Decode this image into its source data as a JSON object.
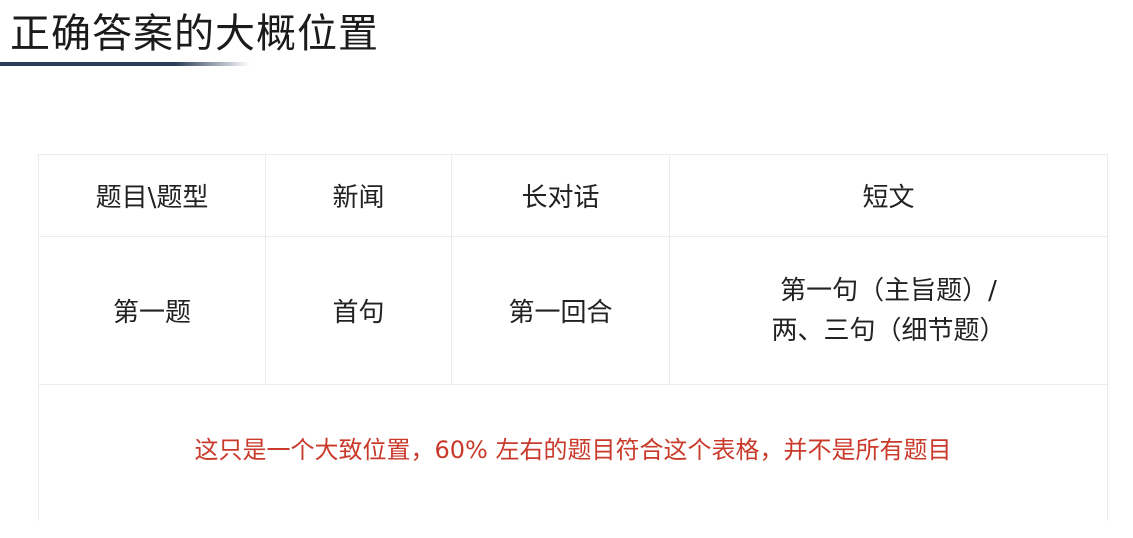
{
  "title": "正确答案的大概位置",
  "table": {
    "headers": [
      "题目\\题型",
      "新闻",
      "长对话",
      "短文"
    ],
    "row": {
      "label": "第一题",
      "news": "首句",
      "long_dialogue": "第一回合",
      "passage_line1": "第一句（主旨题）/",
      "passage_line2": "两、三句（细节题）"
    },
    "note": "这只是一个大致位置，60% 左右的题目符合这个表格，并不是所有题目"
  },
  "colors": {
    "title_underline": "#2a3c58",
    "note_text": "#c93a2b",
    "table_border": "#e9ecef"
  }
}
